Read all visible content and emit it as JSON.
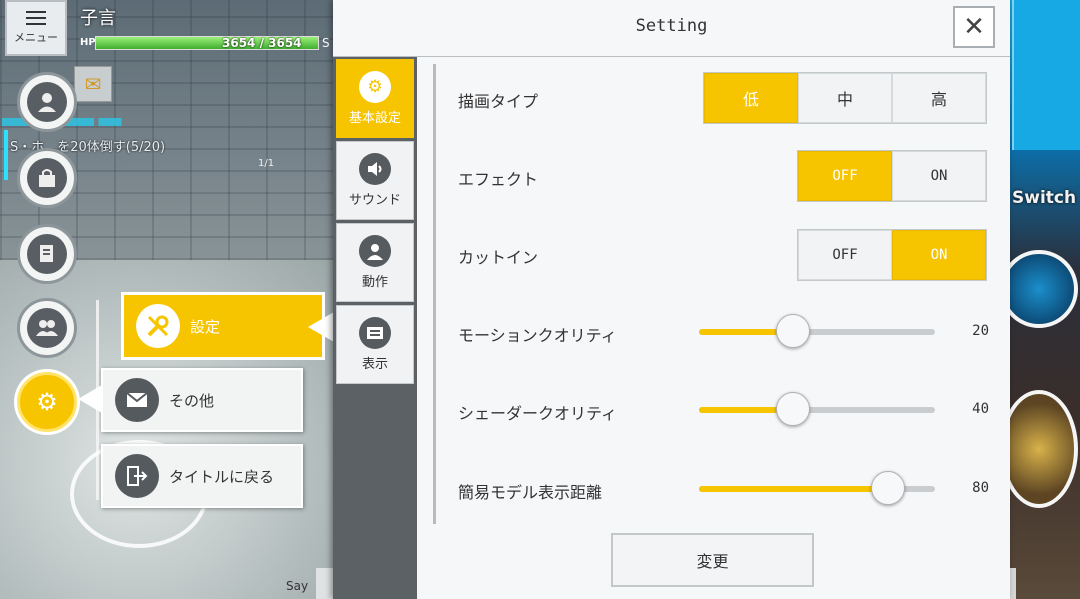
{
  "hud": {
    "menu_label": "メニュー",
    "player_name": "子言",
    "hp_label": "HP",
    "hp_text": "3654 / 3654",
    "hp_extra": "S",
    "hp_fraction": 1.0,
    "quest_text": "S・ホ　を20体倒す(5/20)",
    "quest_small": "1/1",
    "say_label": "Say",
    "switch_label": "Switch"
  },
  "side_menu": {
    "items": [
      {
        "name": "profile",
        "icon": "person-icon"
      },
      {
        "name": "inventory",
        "icon": "bag-icon"
      },
      {
        "name": "quest",
        "icon": "document-icon"
      },
      {
        "name": "friends",
        "icon": "people-icon"
      },
      {
        "name": "settings",
        "icon": "gear-icon"
      }
    ],
    "sub": {
      "settings_label": "設定",
      "other_label": "その他",
      "title_label": "タイトルに戻る"
    }
  },
  "settings": {
    "title": "Setting",
    "tabs": [
      {
        "label": "基本設定",
        "icon": "gear-icon",
        "active": true
      },
      {
        "label": "サウンド",
        "icon": "speaker-icon",
        "active": false
      },
      {
        "label": "動作",
        "icon": "person-icon",
        "active": false
      },
      {
        "label": "表示",
        "icon": "display-icon",
        "active": false
      }
    ],
    "rows": {
      "render_type": {
        "label": "描画タイプ",
        "options": [
          "低",
          "中",
          "高"
        ],
        "selected": "低"
      },
      "effect": {
        "label": "エフェクト",
        "options": [
          "OFF",
          "ON"
        ],
        "selected": "OFF"
      },
      "cut_in": {
        "label": "カットイン",
        "options": [
          "OFF",
          "ON"
        ],
        "selected": "ON"
      }
    },
    "sliders": [
      {
        "label": "モーションクオリティ",
        "value": "20",
        "fraction": 0.4
      },
      {
        "label": "シェーダークオリティ",
        "value": "40",
        "fraction": 0.4
      },
      {
        "label": "簡易モデル表示距離",
        "value": "80",
        "fraction": 0.8
      }
    ],
    "apply_label": "変更"
  },
  "colors": {
    "accent": "#f7c400",
    "panel_bg": "#f6f7f8",
    "tab_bar": "#5c6166"
  }
}
